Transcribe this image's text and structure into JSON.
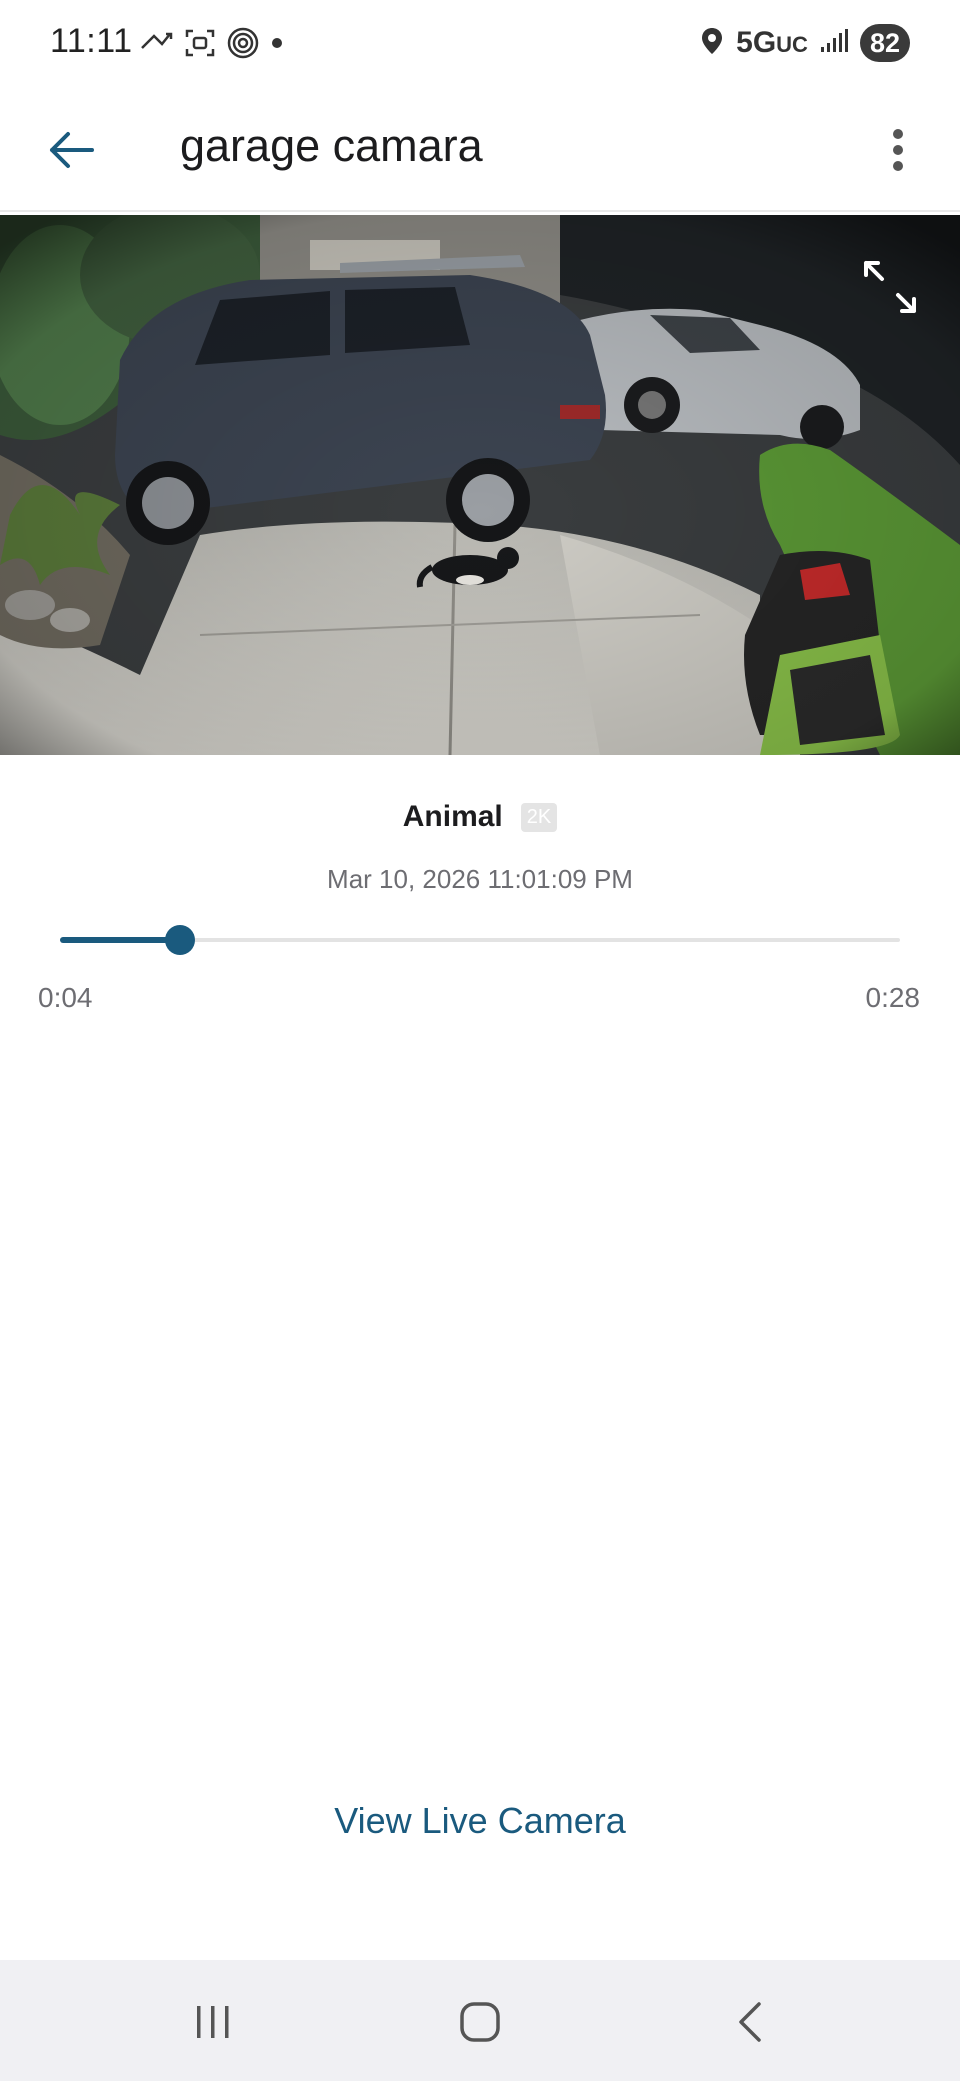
{
  "status_bar": {
    "time": "11:11",
    "network": "5G",
    "network_suffix": "UC",
    "battery": "82",
    "icons_left": [
      "missed-call-icon",
      "screenshot-icon",
      "wireless-icon",
      "dot-icon"
    ],
    "icons_right": [
      "location-icon",
      "signal-icon",
      "battery-icon"
    ]
  },
  "header": {
    "title": "garage camara",
    "back_icon": "back-arrow-icon",
    "menu_icon": "more-vert-icon"
  },
  "video": {
    "fullscreen_icon": "expand-icon"
  },
  "event": {
    "type": "Animal",
    "quality": "2K",
    "timestamp": "Mar 10, 2026 11:01:09 PM"
  },
  "playback": {
    "current": "0:04",
    "duration": "0:28",
    "progress_fraction": 0.143
  },
  "actions": {
    "live_label": "View Live Camera"
  },
  "nav_bar": {
    "buttons": [
      "recents-icon",
      "home-icon",
      "back-icon"
    ]
  },
  "colors": {
    "accent": "#1a5a7e",
    "track": "#e3e3e3",
    "nav_bg": "#f0f0f3"
  }
}
